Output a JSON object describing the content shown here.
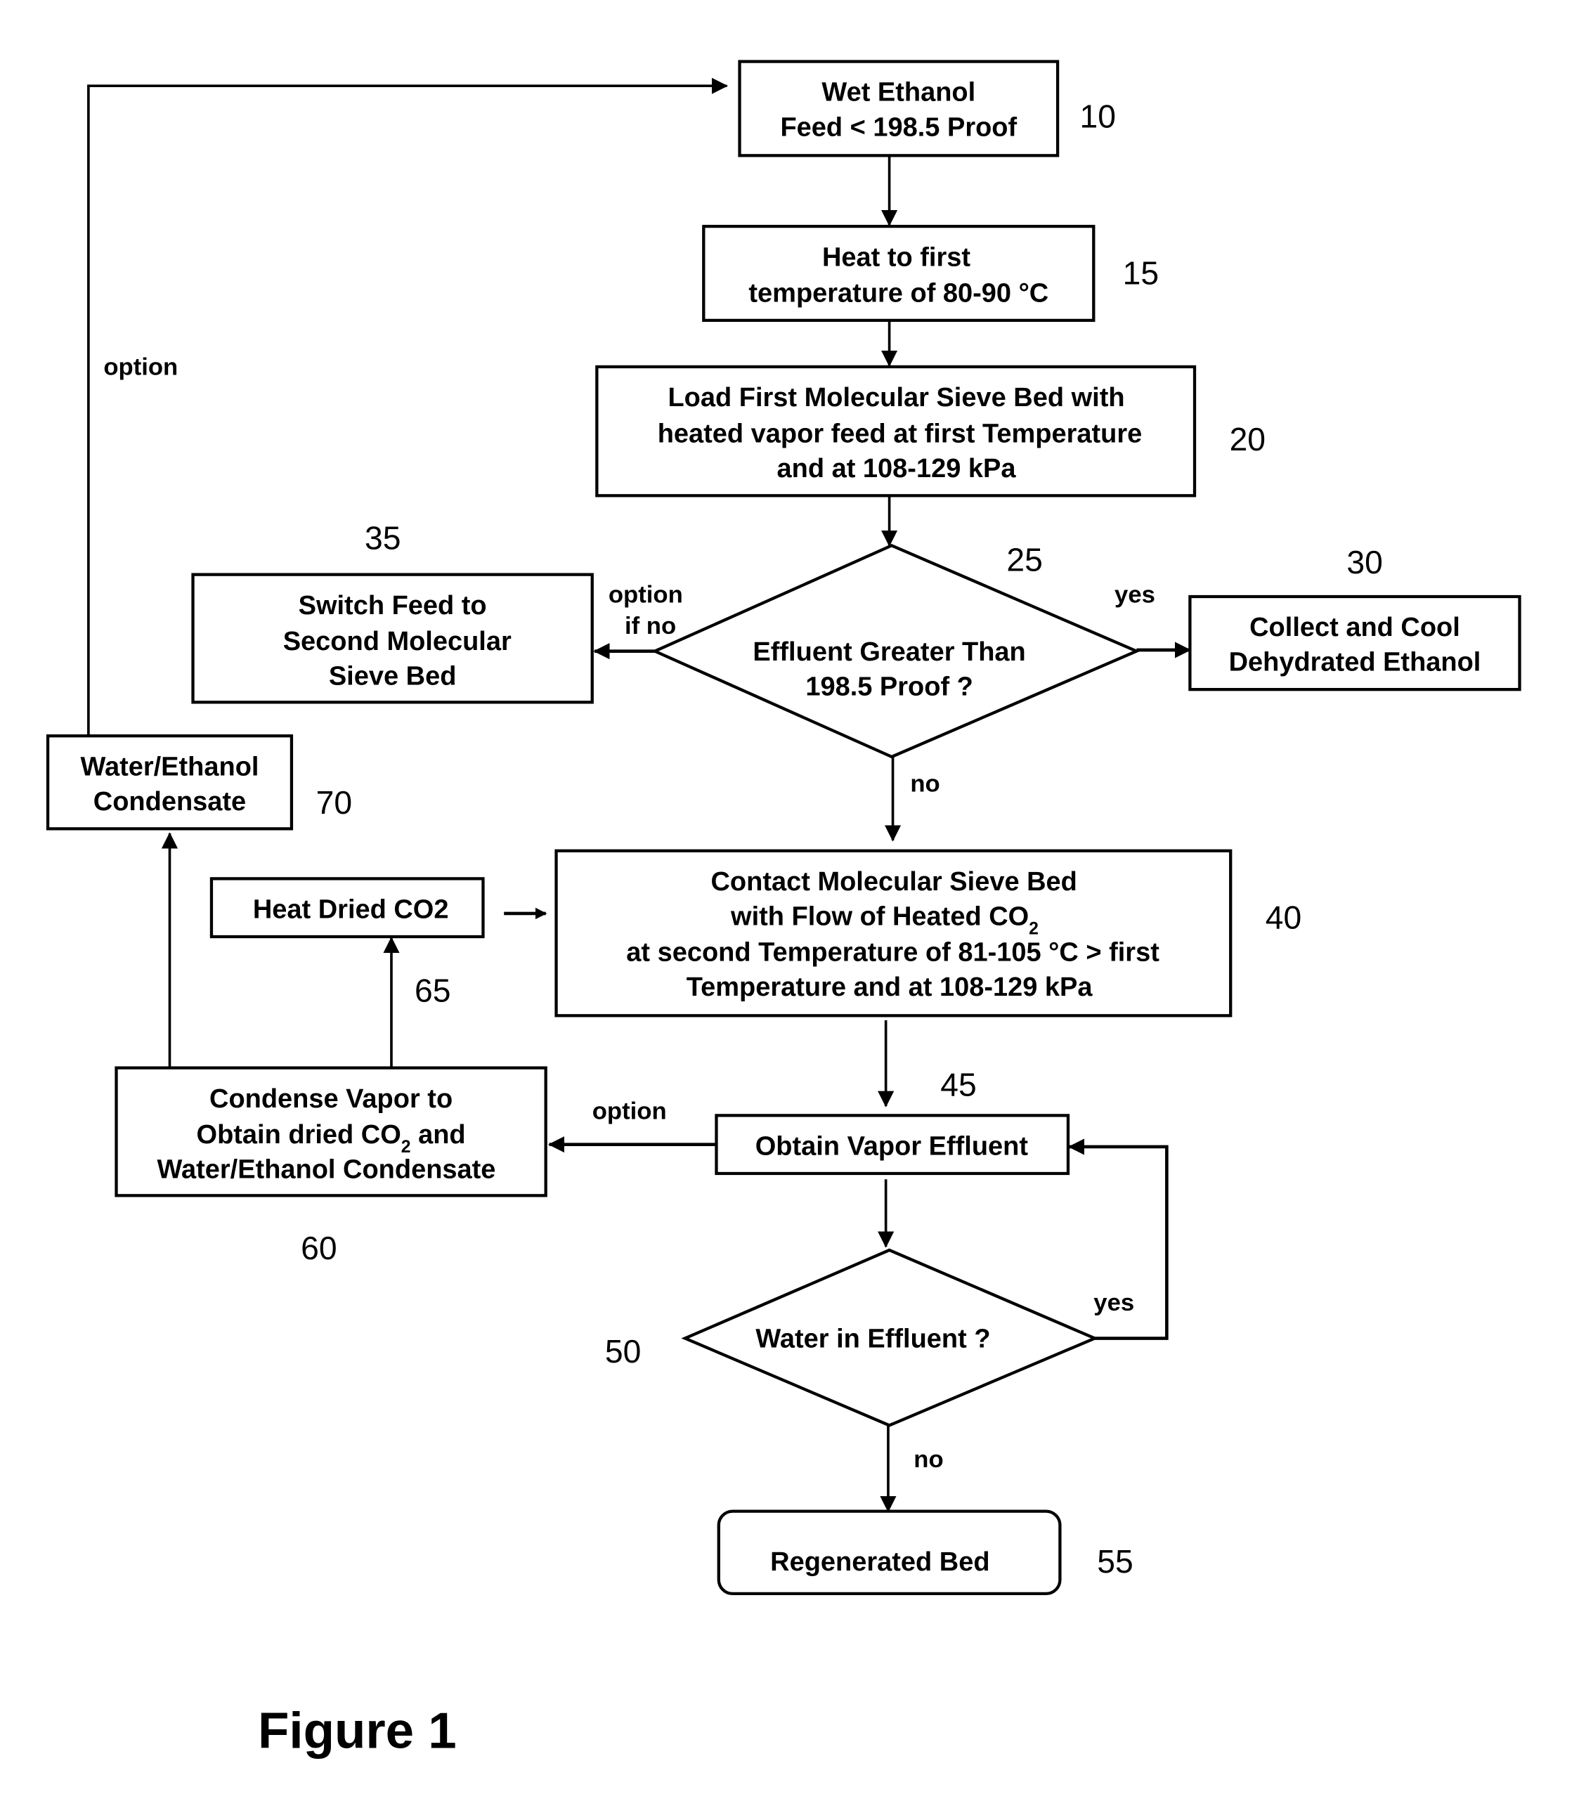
{
  "figure": {
    "caption": "Figure 1",
    "nodes": {
      "n10": {
        "ref": "10",
        "lines": [
          "Wet Ethanol",
          "Feed  < 198.5 Proof"
        ]
      },
      "n15": {
        "ref": "15",
        "lines": [
          "Heat to first",
          "temperature of  80-90 °C"
        ]
      },
      "n20": {
        "ref": "20",
        "lines": [
          "Load First Molecular Sieve Bed with",
          "heated vapor feed at first Temperature",
          "and  at 108-129 kPa"
        ]
      },
      "n25": {
        "ref": "25",
        "lines": [
          "Effluent Greater Than",
          "198.5 Proof ?"
        ]
      },
      "n30": {
        "ref": "30",
        "lines": [
          "Collect and Cool",
          "Dehydrated Ethanol"
        ]
      },
      "n35": {
        "ref": "35",
        "lines": [
          "Switch Feed to",
          "Second Molecular",
          "Sieve Bed"
        ]
      },
      "n40": {
        "ref": "40",
        "lines": [
          "Contact Molecular Sieve Bed",
          "with Flow of Heated CO",
          "at  second Temperature of 81-105  °C > first",
          "Temperature and at 108-129 kPa"
        ],
        "subscript": "2"
      },
      "n45": {
        "ref": "45",
        "lines": [
          "Obtain Vapor Effluent"
        ]
      },
      "n50": {
        "ref": "50",
        "lines": [
          "Water in Effluent ?"
        ]
      },
      "n55": {
        "ref": "55",
        "lines": [
          "Regenerated Bed"
        ]
      },
      "n60": {
        "ref": "60",
        "lines": [
          "Condense Vapor to",
          "Obtain dried CO",
          " and",
          "Water/Ethanol Condensate"
        ],
        "subscript": "2"
      },
      "n65": {
        "ref": "65",
        "lines": [
          "Heat Dried CO2"
        ]
      },
      "n70": {
        "ref": "70",
        "lines": [
          "Water/Ethanol",
          "Condensate"
        ]
      }
    },
    "edge_labels": {
      "option_top": "option",
      "option_if_no_1": "option",
      "option_if_no_2": "if no",
      "yes_25": "yes",
      "no_25": "no",
      "option_45": "option",
      "yes_50": "yes",
      "no_50": "no"
    }
  }
}
